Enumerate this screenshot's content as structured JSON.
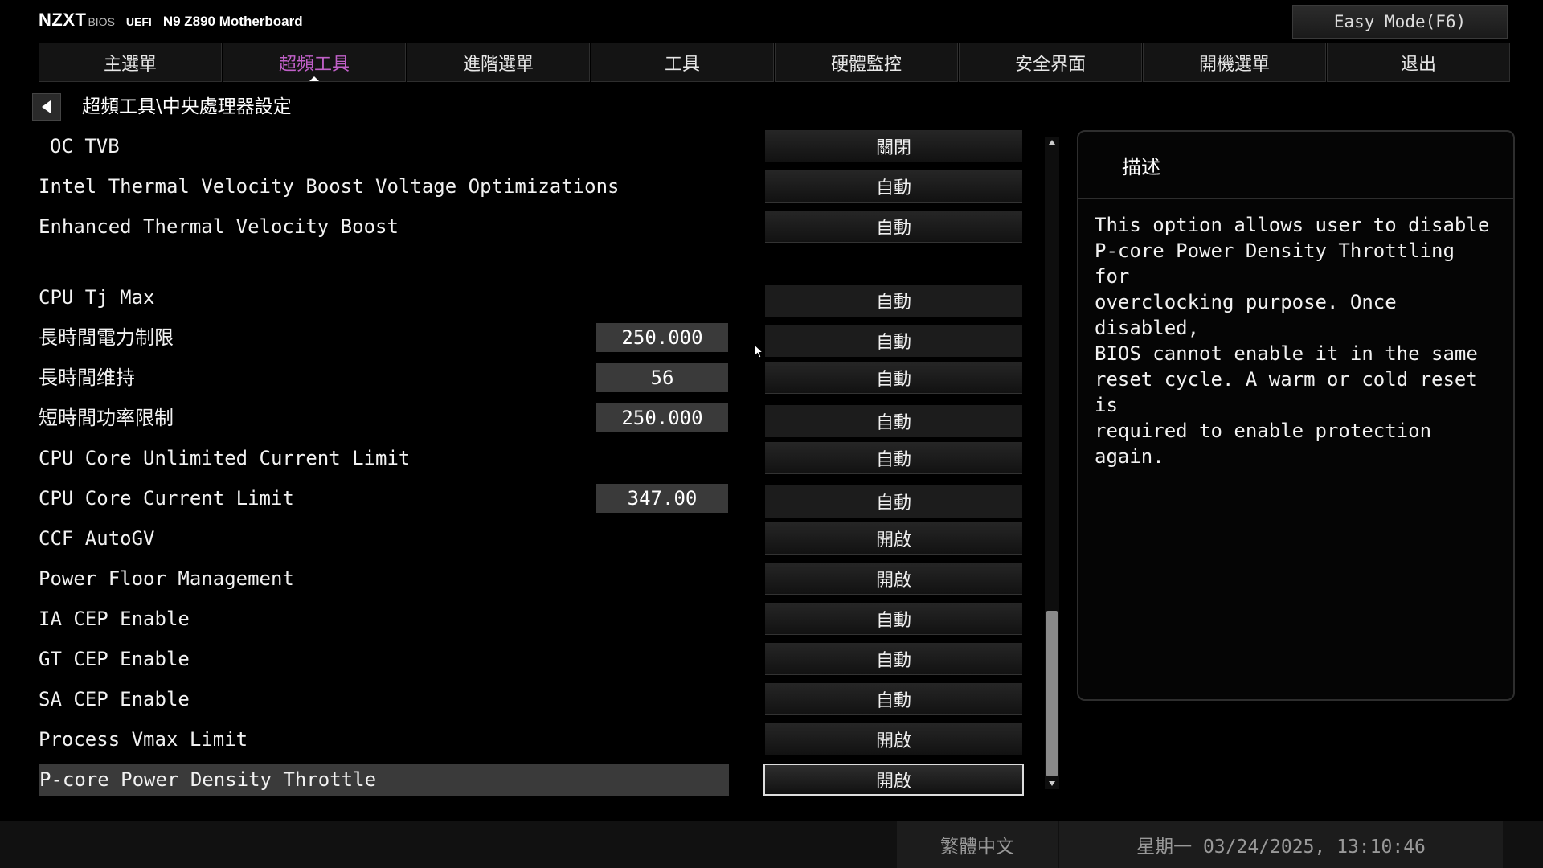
{
  "header": {
    "logo": "NZXT",
    "bios": "BIOS",
    "uefi": "UEFI",
    "model": "N9 Z890 Motherboard",
    "easy_mode": "Easy Mode(F6)"
  },
  "tabs": [
    {
      "label": "主選單"
    },
    {
      "label": "超頻工具",
      "active": true
    },
    {
      "label": "進階選單"
    },
    {
      "label": "工具"
    },
    {
      "label": "硬體監控"
    },
    {
      "label": "安全界面"
    },
    {
      "label": "開機選單"
    },
    {
      "label": "退出"
    }
  ],
  "breadcrumb": "超頻工具\\中央處理器設定",
  "rows": [
    {
      "label": "OC TVB",
      "option": "關閉"
    },
    {
      "label": "Intel Thermal Velocity Boost Voltage Optimizations",
      "option": "自動"
    },
    {
      "label": "Enhanced Thermal Velocity Boost",
      "option": "自動"
    },
    {
      "label": "CPU Tj Max",
      "option": "自動"
    },
    {
      "label": "長時間電力制限",
      "value": "250.000",
      "option": "自動"
    },
    {
      "label": "長時間维持",
      "value": "56",
      "option": "自動"
    },
    {
      "label": "短時間功率限制",
      "value": "250.000",
      "option": "自動"
    },
    {
      "label": "CPU Core Unlimited Current Limit",
      "option": "自動"
    },
    {
      "label": "CPU Core Current Limit",
      "value": "347.00",
      "option": "自動"
    },
    {
      "label": "CCF AutoGV",
      "option": "開啟"
    },
    {
      "label": "Power Floor Management",
      "option": "開啟"
    },
    {
      "label": "IA CEP Enable",
      "option": "自動"
    },
    {
      "label": "GT CEP Enable",
      "option": "自動"
    },
    {
      "label": "SA CEP Enable",
      "option": "自動"
    },
    {
      "label": "Process Vmax Limit",
      "option": "開啟"
    },
    {
      "label": "P-core Power Density Throttle",
      "option": "開啟",
      "selected": true
    }
  ],
  "description": {
    "title": "描述",
    "text": "This option allows user to disable\nP-core Power Density Throttling for\noverclocking purpose. Once disabled,\nBIOS cannot enable it in the same\nreset cycle. A warm or cold reset is\nrequired to enable protection again."
  },
  "footer": {
    "language": "繁體中文",
    "datetime": "星期一 03/24/2025, 13:10:46"
  },
  "colors": {
    "accent": "#c060c8",
    "background": "#000000",
    "field": "#3a3a3a"
  },
  "icons": {
    "back": "back-arrow-icon",
    "scroll_up": "scroll-up-arrow-icon",
    "scroll_down": "scroll-down-arrow-icon",
    "cursor": "mouse-cursor-icon"
  }
}
